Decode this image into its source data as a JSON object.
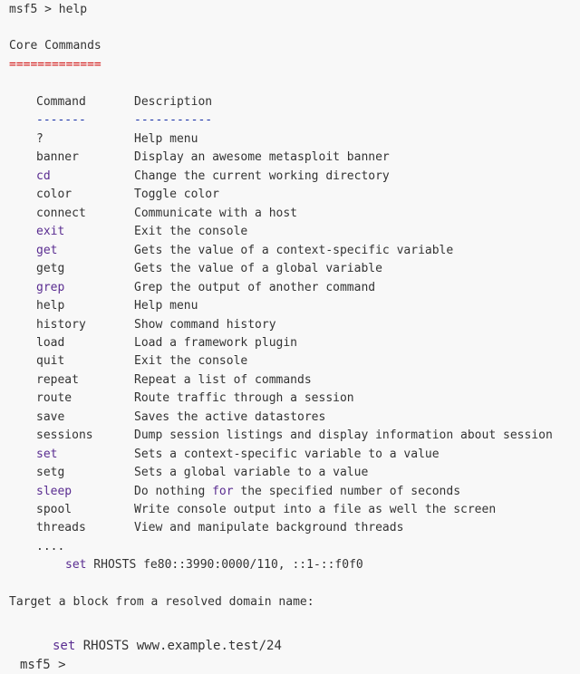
{
  "prompt_line": "msf5 > help",
  "section_title": "Core Commands",
  "section_underline": "=============",
  "header": {
    "command": "Command",
    "description": "Description",
    "command_dash": "-------",
    "description_dash": "-----------"
  },
  "commands": [
    {
      "name": "?",
      "desc": "Help menu",
      "kw": false
    },
    {
      "name": "banner",
      "desc": "Display an awesome metasploit banner",
      "kw": false
    },
    {
      "name": "cd",
      "desc": "Change the current working directory",
      "kw": true
    },
    {
      "name": "color",
      "desc": "Toggle color",
      "kw": false
    },
    {
      "name": "connect",
      "desc": "Communicate with a host",
      "kw": false
    },
    {
      "name": "exit",
      "desc": "Exit the console",
      "kw": true
    },
    {
      "name": "get",
      "desc": "Gets the value of a context-specific variable",
      "kw": true
    },
    {
      "name": "getg",
      "desc": "Gets the value of a global variable",
      "kw": false
    },
    {
      "name": "grep",
      "desc": "Grep the output of another command",
      "kw": true
    },
    {
      "name": "help",
      "desc": "Help menu",
      "kw": false
    },
    {
      "name": "history",
      "desc": "Show command history",
      "kw": false
    },
    {
      "name": "load",
      "desc": "Load a framework plugin",
      "kw": false
    },
    {
      "name": "quit",
      "desc": "Exit the console",
      "kw": false
    },
    {
      "name": "repeat",
      "desc": "Repeat a list of commands",
      "kw": false
    },
    {
      "name": "route",
      "desc": "Route traffic through a session",
      "kw": false
    },
    {
      "name": "save",
      "desc": "Saves the active datastores",
      "kw": false
    },
    {
      "name": "sessions",
      "desc": "Dump session listings and display information about session",
      "kw": false
    },
    {
      "name": "set",
      "desc": "Sets a context-specific variable to a value",
      "kw": true
    },
    {
      "name": "setg",
      "desc": "Sets a global variable to a value",
      "kw": false
    },
    {
      "name": "sleep",
      "desc_pre": "Do nothing ",
      "desc_kw": "for",
      "desc_post": " the specified number of seconds",
      "kw": true
    },
    {
      "name": "spool",
      "desc": "Write console output into a file as well the screen",
      "kw": false
    },
    {
      "name": "threads",
      "desc": "View and manipulate background threads",
      "kw": false
    }
  ],
  "ellipsis": "....",
  "example1": {
    "kw": "set",
    "rest": " RHOSTS fe80::3990:0000/110, ::1-::f0f0"
  },
  "target_text": "Target a block from a resolved domain name:",
  "example2": {
    "kw": "set",
    "rest": " RHOSTS www.example.test/24"
  },
  "final_prompt": "msf5 >",
  "colors": {
    "keyword": "#5a2d91",
    "underline": "#d11111",
    "dash": "#1a32a8",
    "text": "#333333",
    "background": "#f8f8f8"
  }
}
